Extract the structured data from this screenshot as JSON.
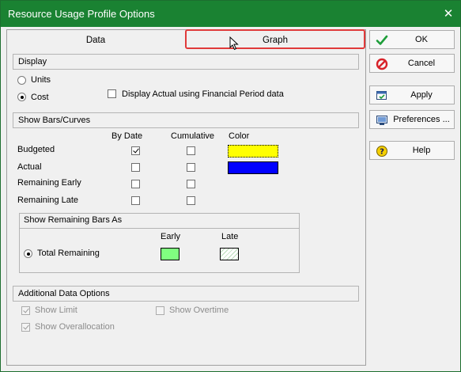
{
  "window": {
    "title": "Resource Usage Profile Options"
  },
  "tabs": [
    {
      "label": "Data"
    },
    {
      "label": "Graph"
    }
  ],
  "display": {
    "header": "Display",
    "units_label": "Units",
    "cost_label": "Cost",
    "selected": "Cost",
    "financial_label": "Display Actual using Financial Period data",
    "financial_checked": false
  },
  "bars": {
    "header": "Show Bars/Curves",
    "col_by_date": "By Date",
    "col_cumulative": "Cumulative",
    "col_color": "Color",
    "rows": [
      {
        "label": "Budgeted",
        "by_date": true,
        "cumulative": false,
        "color": "#ffff00"
      },
      {
        "label": "Actual",
        "by_date": false,
        "cumulative": false,
        "color": "#0000ff"
      },
      {
        "label": "Remaining Early",
        "by_date": false,
        "cumulative": false
      },
      {
        "label": "Remaining Late",
        "by_date": false,
        "cumulative": false
      }
    ]
  },
  "remaining": {
    "header": "Show Remaining Bars As",
    "early_label": "Early",
    "late_label": "Late",
    "option_label": "Total Remaining",
    "early_color": "#80ff80",
    "late_color": "#ffffff"
  },
  "additional": {
    "header": "Additional Data Options",
    "show_limit": "Show Limit",
    "show_limit_checked": true,
    "show_overtime": "Show Overtime",
    "show_overtime_checked": false,
    "show_overallocation": "Show Overallocation",
    "show_overallocation_checked": true
  },
  "buttons": {
    "ok": "OK",
    "cancel": "Cancel",
    "apply": "Apply",
    "preferences": "Preferences ...",
    "help": "Help"
  },
  "icons": {
    "ok": "green-checkmark-icon",
    "cancel": "red-no-icon",
    "apply": "apply-icon",
    "preferences": "preferences-icon",
    "help": "help-icon",
    "close": "close-icon"
  }
}
